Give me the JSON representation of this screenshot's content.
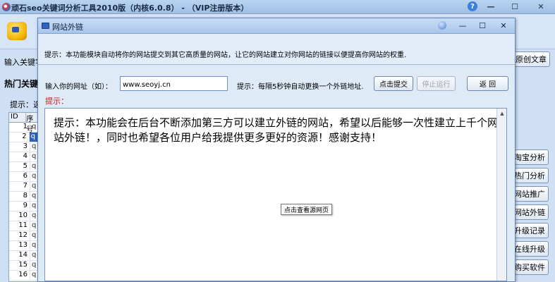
{
  "main_window": {
    "title": "顽石seo关键词分析工具2010版（内核6.0.8） - （VIP注册版本）",
    "min_label": "—",
    "max_label": "☐",
    "close_label": "✕",
    "help_label": "?"
  },
  "main_toolbar": {
    "keyword_label": "输入关键字",
    "original_btn": "原创文章"
  },
  "left_panel": {
    "hot_label": "热门关键",
    "tip_label": "提示：选拔",
    "table_headers": [
      "ID",
      "序号"
    ],
    "rows": [
      {
        "id": "1",
        "val": "q"
      },
      {
        "id": "2",
        "val": "q"
      },
      {
        "id": "3",
        "val": "q"
      },
      {
        "id": "4",
        "val": "q"
      },
      {
        "id": "5",
        "val": "q"
      },
      {
        "id": "6",
        "val": "q"
      },
      {
        "id": "7",
        "val": "q"
      },
      {
        "id": "8",
        "val": "q"
      },
      {
        "id": "9",
        "val": "q"
      },
      {
        "id": "10",
        "val": "q"
      },
      {
        "id": "11",
        "val": "q"
      },
      {
        "id": "12",
        "val": "q"
      },
      {
        "id": "13",
        "val": "q"
      },
      {
        "id": "14",
        "val": "q"
      },
      {
        "id": "15",
        "val": "q"
      },
      {
        "id": "16",
        "val": "q"
      }
    ]
  },
  "side_buttons": [
    "淘宝分析",
    "热门分析",
    "网站推广",
    "网站外链",
    "升级记录",
    "在线升级",
    "购买软件"
  ],
  "dialog": {
    "title": "网站外链",
    "min_label": "—",
    "max_label": "☐",
    "close_label": "✕",
    "notice": "提示：本功能模块自动将你的网站提交到其它高质量的网站，让它的网站建立对你网站的链接以便提高你网站的权重.",
    "url_label": "输入你的网址（如）：",
    "url_value": "www.seoyj.cn",
    "tip_interval": "提示：每隔5秒钟自动更换一个外链地址.",
    "submit_btn": "点击提交",
    "stop_btn": "停止运行",
    "back_btn": "返  回",
    "red_tip": "提示：",
    "message": "提示：本功能会在后台不断添加第三方可以建立外链的网站，希望以后能够一次性建立上千个网站外链！，同时也希望各位用户给我提供更多更好的资源！感谢支持！",
    "tooltip": "点击查看源网页"
  }
}
